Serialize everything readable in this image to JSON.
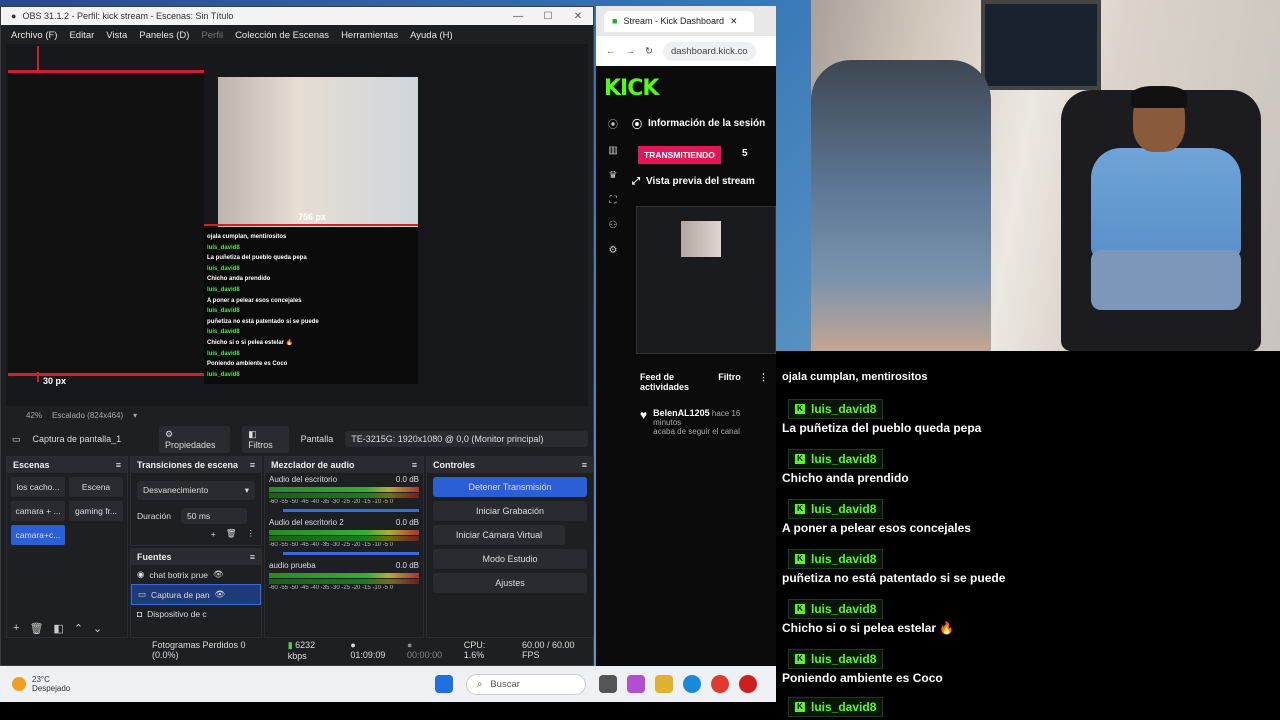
{
  "obs": {
    "title": "OBS 31.1.2 - Perfil: kick stream - Escenas: Sin Título",
    "menu": [
      "Archivo (F)",
      "Editar",
      "Vista",
      "Paneles (D)",
      "Perfil",
      "Colección de Escenas",
      "Herramientas",
      "Ayuda (H)"
    ],
    "preview_measure_top": "30 px",
    "preview_measure_right": "756 px",
    "mini_chat_lines": [
      {
        "user": "",
        "text": "ojala cumplan, mentirositos"
      },
      {
        "user": "luis_david8",
        "text": "La puñetiza del pueblo queda pepa"
      },
      {
        "user": "luis_david8",
        "text": "Chicho anda prendido"
      },
      {
        "user": "luis_david8",
        "text": "A poner a pelear esos concejales"
      },
      {
        "user": "luis_david8",
        "text": "puñetiza no está patentado si se puede"
      },
      {
        "user": "luis_david8",
        "text": "Chicho si o si pelea estelar 🔥"
      },
      {
        "user": "luis_david8",
        "text": "Poniendo ambiente es Coco"
      },
      {
        "user": "luis_david8",
        "text": ""
      }
    ],
    "zoom": "42%",
    "scaling": "Escalado (824x464)",
    "source_name": "Captura de pantalla_1",
    "properties_label": "Propiedades",
    "filters_label": "Filtros",
    "screen_label": "Pantalla",
    "screen_value": "TE-3215G: 1920x1080 @ 0,0 (Monitor principal)",
    "scenes": {
      "title": "Escenas",
      "items": [
        {
          "label": "los cacho...",
          "active": false
        },
        {
          "label": "Escena",
          "active": false
        },
        {
          "label": "camara + ...",
          "active": false
        },
        {
          "label": "gaming fr...",
          "active": false
        },
        {
          "label": "camara+c...",
          "active": true
        }
      ]
    },
    "transitions": {
      "title": "Transiciones de escena",
      "selected": "Desvanecimiento",
      "duration_label": "Duración",
      "duration_value": "50 ms"
    },
    "sources": {
      "title": "Fuentes",
      "items": [
        {
          "label": "chat botrix prue",
          "icon": "globe-icon",
          "active": false
        },
        {
          "label": "Captura de pan",
          "icon": "monitor-icon",
          "active": true
        },
        {
          "label": "Dispositivo de c",
          "icon": "camera-icon",
          "active": false
        }
      ]
    },
    "mixer": {
      "title": "Mezclador de audio",
      "scale": "-60 -55 -50 -45 -40 -35 -30 -25 -20 -15 -10 -5 0",
      "channels": [
        {
          "name": "Audio del escritorio",
          "db": "0.0 dB"
        },
        {
          "name": "Audio del escritorio 2",
          "db": "0.0 dB"
        },
        {
          "name": "audio prueba",
          "db": "0.0 dB"
        }
      ]
    },
    "controls": {
      "title": "Controles",
      "buttons": [
        "Detener Transmisión",
        "Iniciar Grabación",
        "Iniciar Cámara Virtual",
        "Modo Estudio",
        "Ajustes"
      ]
    },
    "status": {
      "dropped": "Fotogramas Perdidos 0 (0.0%)",
      "bitrate": "6232 kbps",
      "live_time": "01:09:09",
      "rec_time": "00:00:00",
      "cpu": "CPU: 1.6%",
      "fps": "60.00 / 60.00 FPS"
    }
  },
  "browser": {
    "tab_title": "Stream - Kick Dashboard",
    "url": "dashboard.kick.co",
    "logo": "KICK",
    "session_title": "Información de la sesión",
    "live_badge": "TRANSMITIENDO",
    "viewer_count": "5",
    "preview_title": "Vista previa del stream",
    "feed_title": "Feed de actividades",
    "filter_label": "Filtro",
    "feed_item": {
      "name": "BelenAL1205",
      "time": "hace 16 minutos",
      "text": "acaba de seguir el canal"
    }
  },
  "chat": {
    "first_line": "ojala cumplan, mentirositos",
    "messages": [
      {
        "user": "luis_david8",
        "text": "La puñetiza del pueblo queda pepa"
      },
      {
        "user": "luis_david8",
        "text": "Chicho anda prendido"
      },
      {
        "user": "luis_david8",
        "text": "A poner a pelear esos concejales"
      },
      {
        "user": "luis_david8",
        "text": "puñetiza no está patentado si se puede"
      },
      {
        "user": "luis_david8",
        "text": "Chicho si o si pelea estelar 🔥"
      },
      {
        "user": "luis_david8",
        "text": "Poniendo ambiente es Coco"
      },
      {
        "user": "luis_david8",
        "text": ""
      }
    ]
  },
  "taskbar": {
    "temp": "23°C",
    "weather": "Despejado",
    "search_placeholder": "Buscar"
  }
}
